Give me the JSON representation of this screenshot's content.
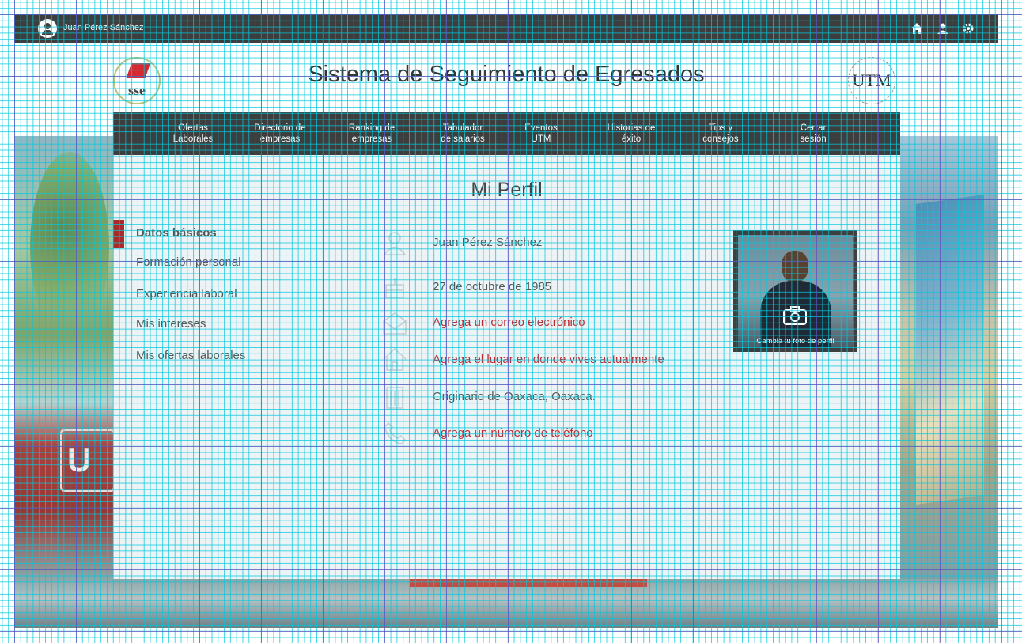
{
  "user": {
    "name": "Juan Pérez Sánchez"
  },
  "topbar": {
    "icons": [
      "home-icon",
      "user-icon",
      "settings-icon"
    ]
  },
  "header": {
    "title": "Sistema de Seguimiento de Egresados",
    "logo_left_text": "sse",
    "logo_right_text": "UTM"
  },
  "nav": {
    "items": [
      {
        "label": "Ofertas\nLaborales"
      },
      {
        "label": "Directorio de\nempresas"
      },
      {
        "label": "Ranking de\nempresas"
      },
      {
        "label": "Tabulador\nde salarios"
      },
      {
        "label": "Eventos\nUTM"
      },
      {
        "label": "Historias de\néxito"
      },
      {
        "label": "Tips y\nconsejos"
      },
      {
        "label": "Cerrar\nsesión"
      }
    ]
  },
  "profile": {
    "title": "Mi Perfil",
    "menu": [
      {
        "label": "Datos básicos",
        "active": true
      },
      {
        "label": "Formación personal"
      },
      {
        "label": "Experiencia laboral"
      },
      {
        "label": "Mis intereses"
      },
      {
        "label": "Mis ofertas laborales"
      }
    ],
    "info": [
      {
        "icon": "person-icon",
        "text": "Juan Pérez Sánchez",
        "link": false
      },
      {
        "icon": "birthday-cake-icon",
        "text": "27 de octubre de 1985",
        "link": false
      },
      {
        "icon": "envelope-icon",
        "text": "Agrega un correo electrónico",
        "link": true
      },
      {
        "icon": "house-icon",
        "text": "Agrega el lugar en donde vives actualmente",
        "link": true
      },
      {
        "icon": "building-icon",
        "text": "Originario de Oaxaca, Oaxaca.",
        "link": false
      },
      {
        "icon": "phone-icon",
        "text": "Agrega un número de teléfono",
        "link": true
      }
    ],
    "photo_caption": "Cambia tu foto de perfil"
  },
  "colors": {
    "bar": "#3d3d3d",
    "accent": "#a82a2a",
    "link": "#c0272d"
  }
}
